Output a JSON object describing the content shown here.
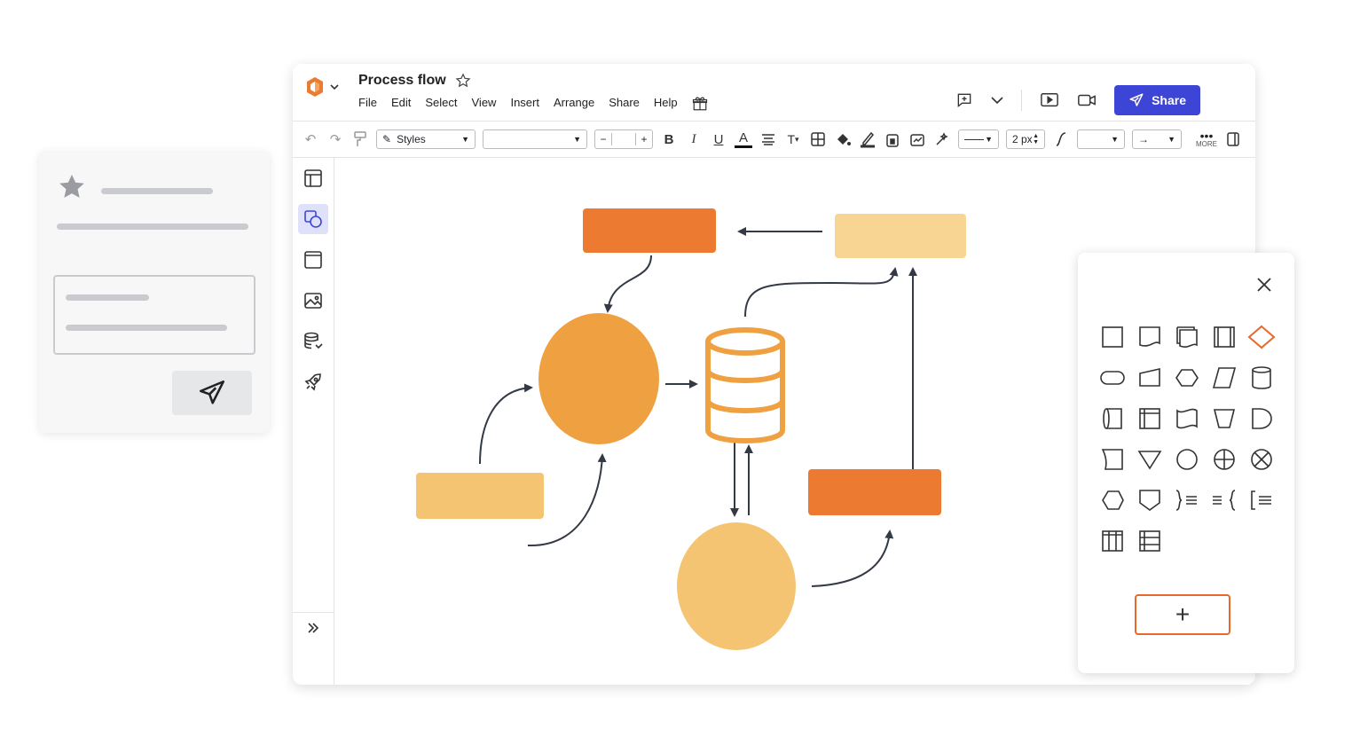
{
  "app": {
    "document_title": "Process flow",
    "menu": [
      "File",
      "Edit",
      "Select",
      "View",
      "Insert",
      "Arrange",
      "Share",
      "Help"
    ],
    "share_label": "Share"
  },
  "toolbar": {
    "styles_label": "Styles",
    "font_select_value": "",
    "font_size_minus": "−",
    "font_size_plus": "+",
    "bold": "B",
    "italic": "I",
    "underline": "U",
    "text_color": "A",
    "line_width": "2 px",
    "more_label": "MORE"
  },
  "colors": {
    "accent": "#3d45d6",
    "orange_dark": "#ec7b31",
    "orange_mid": "#efa041",
    "orange_light": "#f5c472",
    "orange_pale": "#f8d592",
    "highlight": "#e8692b"
  },
  "shape_panel": {
    "close_icon": "close-icon",
    "add_label": "+"
  }
}
